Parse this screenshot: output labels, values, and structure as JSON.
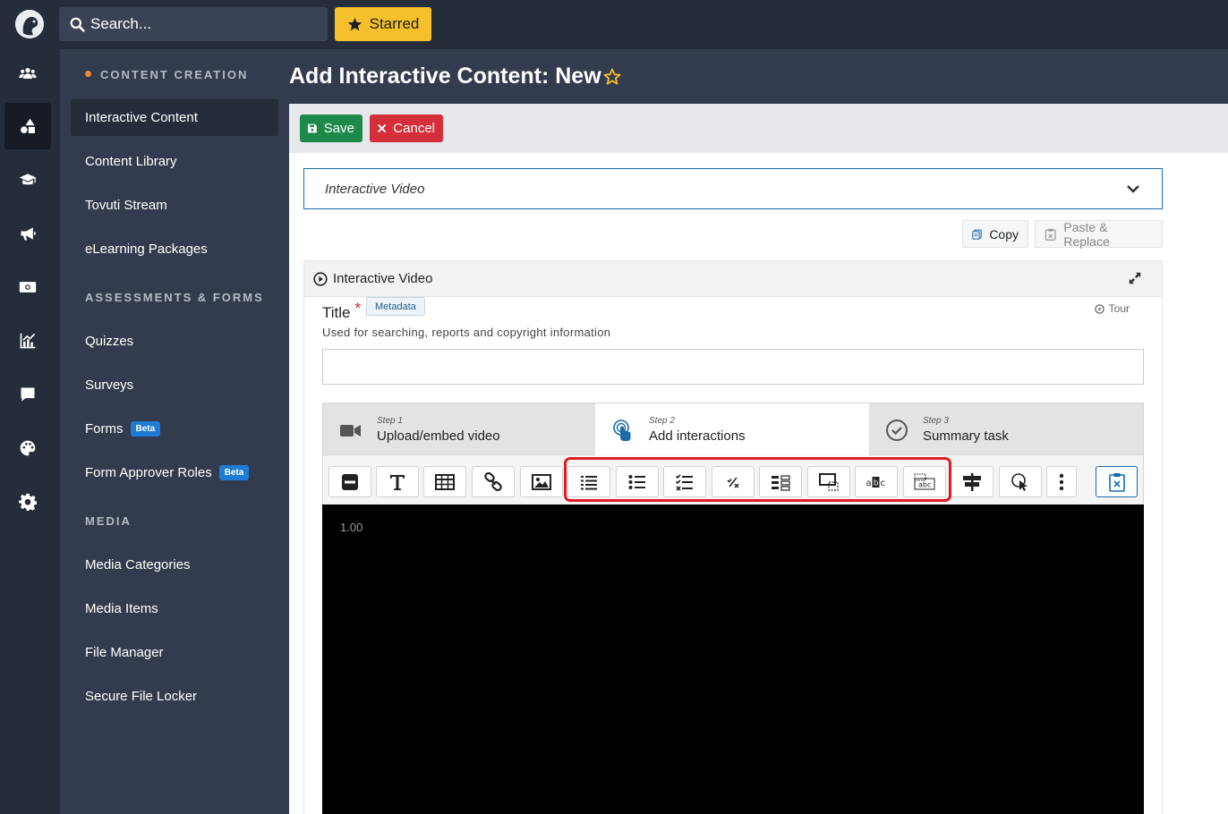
{
  "topbar": {
    "search_placeholder": "Search...",
    "starred_label": "Starred"
  },
  "rail": {
    "icons": [
      "users-icon",
      "shapes-icon",
      "graduation-cap-icon",
      "megaphone-icon",
      "money-icon",
      "analytics-icon",
      "chat-icon",
      "palette-icon",
      "gear-icon"
    ],
    "active_index": 1
  },
  "sidebar": {
    "section_content": "CONTENT CREATION",
    "items_content": [
      {
        "label": "Interactive Content",
        "active": true
      },
      {
        "label": "Content Library"
      },
      {
        "label": "Tovuti Stream"
      },
      {
        "label": "eLearning Packages"
      }
    ],
    "section_assessments": "ASSESSMENTS & FORMS",
    "items_assessments": [
      {
        "label": "Quizzes"
      },
      {
        "label": "Surveys"
      },
      {
        "label": "Forms",
        "badge": "Beta"
      },
      {
        "label": "Form Approver Roles",
        "badge": "Beta"
      }
    ],
    "section_media": "MEDIA",
    "items_media": [
      {
        "label": "Media Categories"
      },
      {
        "label": "Media Items"
      },
      {
        "label": "File Manager"
      },
      {
        "label": "Secure File Locker"
      }
    ]
  },
  "page": {
    "title": "Add Interactive Content: New"
  },
  "actions": {
    "save_label": "Save",
    "cancel_label": "Cancel"
  },
  "editor": {
    "content_type": "Interactive Video",
    "copy_label": "Copy",
    "paste_label": "Paste & Replace",
    "panel_title": "Interactive Video",
    "title_label": "Title",
    "required_mark": "*",
    "metadata_tag": "Metadata",
    "tour_label": "Tour",
    "help_text": "Used for searching, reports and copyright information",
    "title_value": ""
  },
  "steps": [
    {
      "number": "Step 1",
      "title": "Upload/embed video",
      "icon": "video-camera-icon"
    },
    {
      "number": "Step 2",
      "title": "Add interactions",
      "icon": "touch-pointer-icon",
      "active": true
    },
    {
      "number": "Step 3",
      "title": "Summary task",
      "icon": "check-circle-icon"
    }
  ],
  "toolbar": {
    "tools": [
      "label-tool",
      "text-tool",
      "table-tool",
      "link-tool",
      "image-tool",
      "statements-tool",
      "single-choice-tool",
      "multiple-choice-tool",
      "true-false-tool",
      "drag-and-drop-tool",
      "mark-the-words-tool",
      "fill-in-blanks-tool",
      "drag-text-tool",
      "crossroads-tool",
      "navigation-hotspot-tool",
      "more-tool",
      "paste-tool"
    ],
    "highlighted_group": [
      "statements-tool",
      "single-choice-tool",
      "multiple-choice-tool",
      "true-false-tool",
      "drag-and-drop-tool",
      "mark-the-words-tool",
      "fill-in-blanks-tool",
      "drag-text-tool"
    ]
  },
  "video": {
    "timestamp": "1.00"
  },
  "colors": {
    "starred": "#f5c02b",
    "save": "#1e8a4a",
    "cancel": "#d52f3c",
    "beta": "#1f7bd8",
    "highlight": "#e01b24",
    "accent_dot": "#f0863b"
  }
}
